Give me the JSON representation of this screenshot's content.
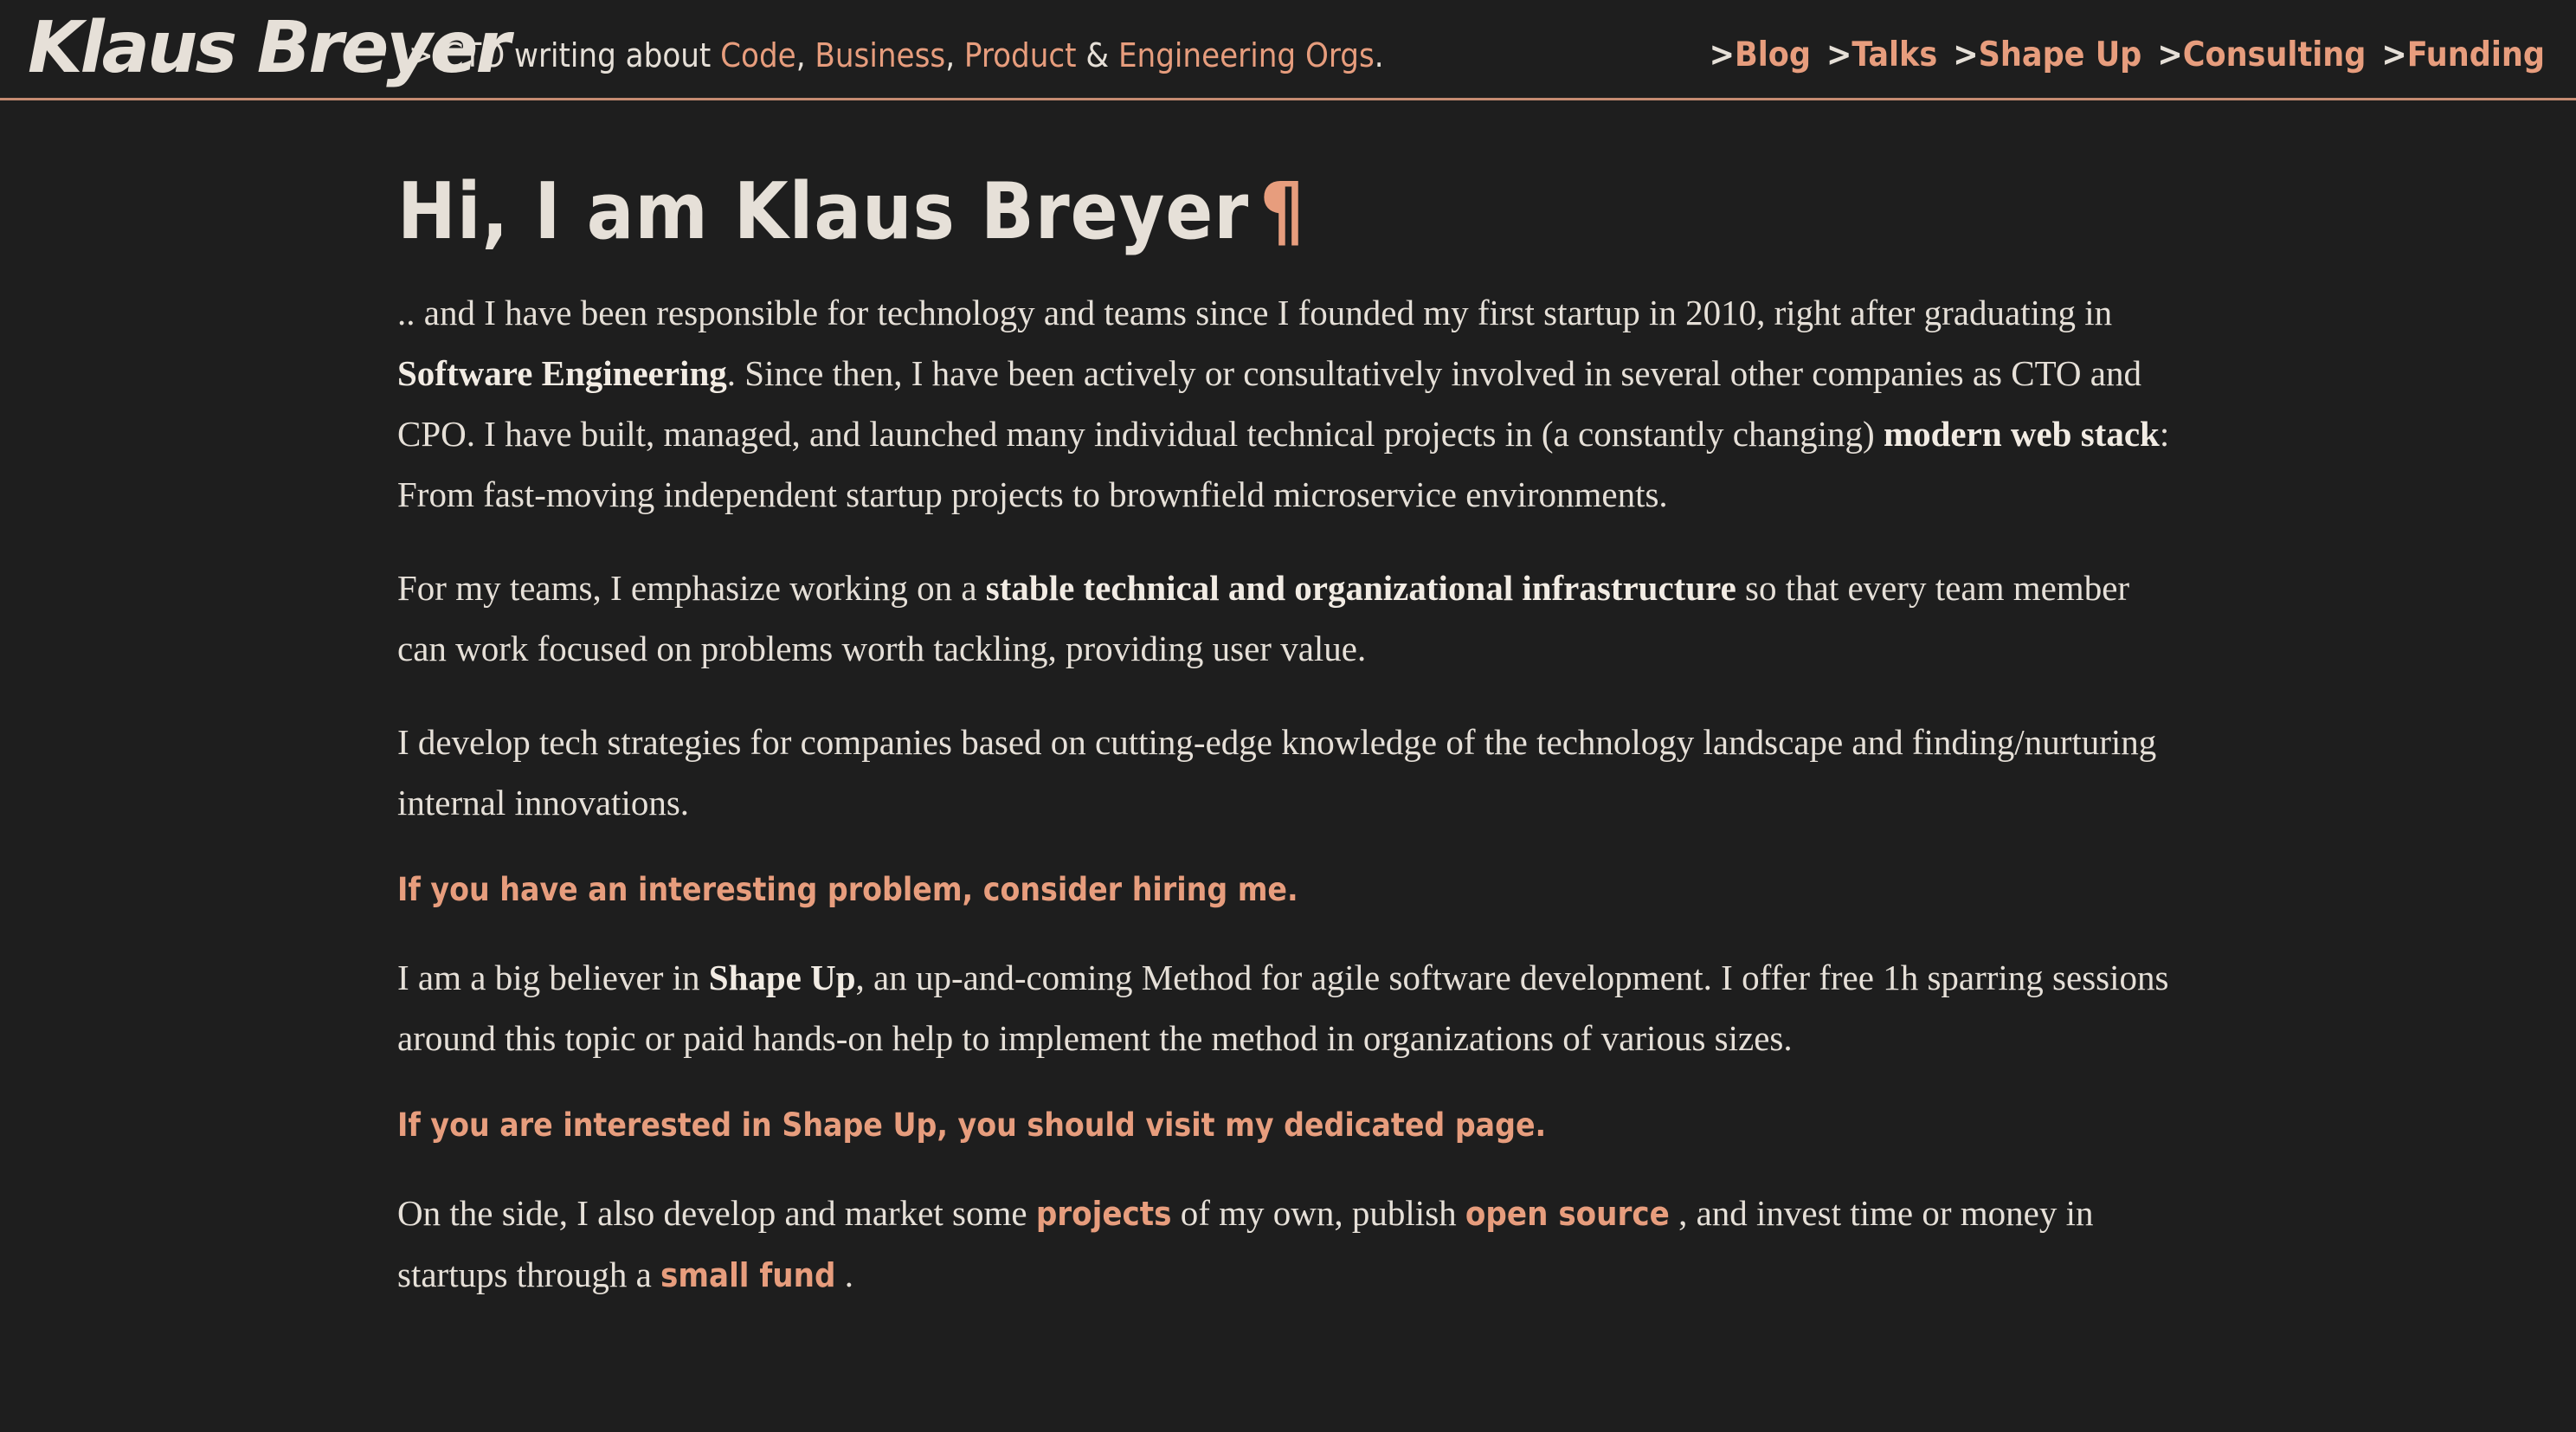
{
  "header": {
    "brand": "Klaus Breyer",
    "tagline": {
      "prefix": "> CTO writing about ",
      "code": "Code",
      "sep1": ", ",
      "business": "Business",
      "sep2": ", ",
      "product": "Product",
      "amp": " & ",
      "engineering": "Engineering Orgs",
      "end": "."
    },
    "nav": [
      {
        "arrow": ">",
        "label": "Blog"
      },
      {
        "arrow": ">",
        "label": "Talks"
      },
      {
        "arrow": ">",
        "label": "Shape Up"
      },
      {
        "arrow": ">",
        "label": "Consulting"
      },
      {
        "arrow": ">",
        "label": "Funding"
      }
    ]
  },
  "main": {
    "title": "Hi, I am Klaus Breyer",
    "pilcrow": "¶",
    "p1": {
      "a": ".. and I have been responsible for technology and teams since I founded my first startup in 2010, right after graduating in ",
      "b1": "Software Engineering",
      "c": ". Since then, I have been actively or consultatively involved in several other companies as CTO and CPO. I have built, managed, and launched many individual technical projects in (a constantly changing) ",
      "b2": "modern web stack",
      "d": ": From fast-moving independent startup projects to brownfield microservice environments."
    },
    "p2": {
      "a": "For my teams, I emphasize working on a ",
      "b": "stable technical and organizational infrastructure",
      "c": " so that every team member can work focused on problems worth tackling, providing user value."
    },
    "p3": "I develop tech strategies for companies based on cutting-edge knowledge of the technology landscape and finding/nurturing internal innovations.",
    "cta1": "If you have an interesting problem, consider hiring me.",
    "p4": {
      "a": "I am a big believer in ",
      "b": "Shape Up",
      "c": ", an up-and-coming Method for agile software development. I offer free 1h sparring sessions around this topic or paid hands-on help to implement the method in organizations of various sizes."
    },
    "cta2": "If you are interested in Shape Up, you should visit my dedicated page.",
    "p5": {
      "a": "On the side, I also develop and market some ",
      "link1": "projects",
      "b": " of my own, publish ",
      "link2": "open source",
      "c": " , and invest time or money in startups through a ",
      "link3": "small fund",
      "d": " ."
    }
  },
  "colors": {
    "background": "#1e1e1e",
    "text": "#e6e0d8",
    "accent": "#e79d7d"
  }
}
